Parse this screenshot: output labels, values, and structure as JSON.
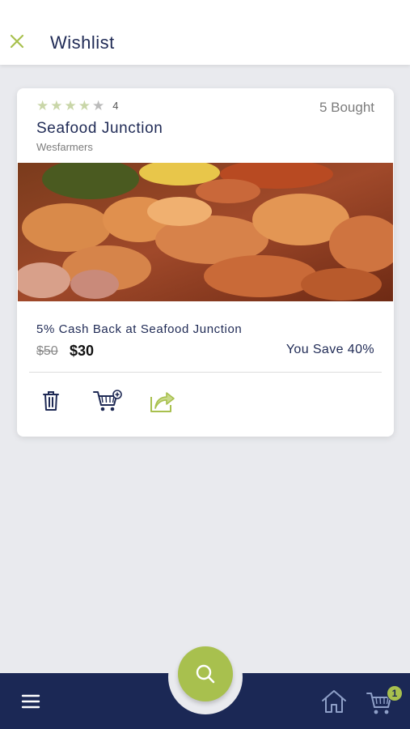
{
  "header": {
    "title": "Wishlist",
    "close_icon": "close-icon"
  },
  "colors": {
    "accent": "#a8c04e",
    "navy": "#1b2855",
    "background": "#e9eaee"
  },
  "deal": {
    "rating": 4,
    "rating_label": "4",
    "rating_max": 5,
    "bought": "5 Bought",
    "title": "Seafood Junction",
    "merchant": "Wesfarmers",
    "image": "seafood-boil-photo",
    "description": "5% Cash Back at Seafood Junction",
    "old_price": "$50",
    "new_price": "$30",
    "savings": "You Save 40%",
    "actions": [
      "trash-icon",
      "add-to-cart-icon",
      "share-icon"
    ]
  },
  "bottom_nav": {
    "items": [
      "menu-icon",
      "search-icon",
      "home-icon",
      "cart-icon"
    ],
    "cart_count": "1"
  }
}
